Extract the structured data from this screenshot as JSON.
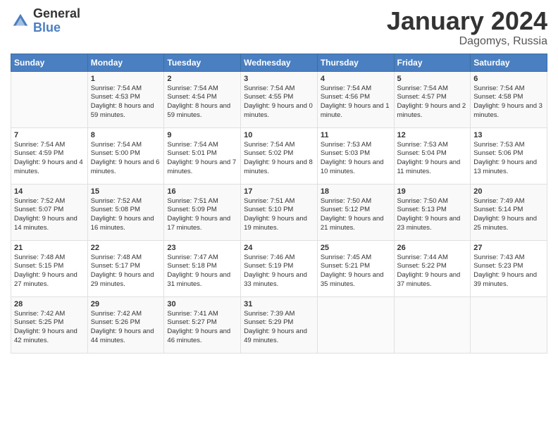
{
  "header": {
    "logo_general": "General",
    "logo_blue": "Blue",
    "month_title": "January 2024",
    "subtitle": "Dagomys, Russia"
  },
  "days_of_week": [
    "Sunday",
    "Monday",
    "Tuesday",
    "Wednesday",
    "Thursday",
    "Friday",
    "Saturday"
  ],
  "weeks": [
    [
      {
        "day": "",
        "sunrise": "",
        "sunset": "",
        "daylight": ""
      },
      {
        "day": "1",
        "sunrise": "Sunrise: 7:54 AM",
        "sunset": "Sunset: 4:53 PM",
        "daylight": "Daylight: 8 hours and 59 minutes."
      },
      {
        "day": "2",
        "sunrise": "Sunrise: 7:54 AM",
        "sunset": "Sunset: 4:54 PM",
        "daylight": "Daylight: 8 hours and 59 minutes."
      },
      {
        "day": "3",
        "sunrise": "Sunrise: 7:54 AM",
        "sunset": "Sunset: 4:55 PM",
        "daylight": "Daylight: 9 hours and 0 minutes."
      },
      {
        "day": "4",
        "sunrise": "Sunrise: 7:54 AM",
        "sunset": "Sunset: 4:56 PM",
        "daylight": "Daylight: 9 hours and 1 minute."
      },
      {
        "day": "5",
        "sunrise": "Sunrise: 7:54 AM",
        "sunset": "Sunset: 4:57 PM",
        "daylight": "Daylight: 9 hours and 2 minutes."
      },
      {
        "day": "6",
        "sunrise": "Sunrise: 7:54 AM",
        "sunset": "Sunset: 4:58 PM",
        "daylight": "Daylight: 9 hours and 3 minutes."
      }
    ],
    [
      {
        "day": "7",
        "sunrise": "Sunrise: 7:54 AM",
        "sunset": "Sunset: 4:59 PM",
        "daylight": "Daylight: 9 hours and 4 minutes."
      },
      {
        "day": "8",
        "sunrise": "Sunrise: 7:54 AM",
        "sunset": "Sunset: 5:00 PM",
        "daylight": "Daylight: 9 hours and 6 minutes."
      },
      {
        "day": "9",
        "sunrise": "Sunrise: 7:54 AM",
        "sunset": "Sunset: 5:01 PM",
        "daylight": "Daylight: 9 hours and 7 minutes."
      },
      {
        "day": "10",
        "sunrise": "Sunrise: 7:54 AM",
        "sunset": "Sunset: 5:02 PM",
        "daylight": "Daylight: 9 hours and 8 minutes."
      },
      {
        "day": "11",
        "sunrise": "Sunrise: 7:53 AM",
        "sunset": "Sunset: 5:03 PM",
        "daylight": "Daylight: 9 hours and 10 minutes."
      },
      {
        "day": "12",
        "sunrise": "Sunrise: 7:53 AM",
        "sunset": "Sunset: 5:04 PM",
        "daylight": "Daylight: 9 hours and 11 minutes."
      },
      {
        "day": "13",
        "sunrise": "Sunrise: 7:53 AM",
        "sunset": "Sunset: 5:06 PM",
        "daylight": "Daylight: 9 hours and 13 minutes."
      }
    ],
    [
      {
        "day": "14",
        "sunrise": "Sunrise: 7:52 AM",
        "sunset": "Sunset: 5:07 PM",
        "daylight": "Daylight: 9 hours and 14 minutes."
      },
      {
        "day": "15",
        "sunrise": "Sunrise: 7:52 AM",
        "sunset": "Sunset: 5:08 PM",
        "daylight": "Daylight: 9 hours and 16 minutes."
      },
      {
        "day": "16",
        "sunrise": "Sunrise: 7:51 AM",
        "sunset": "Sunset: 5:09 PM",
        "daylight": "Daylight: 9 hours and 17 minutes."
      },
      {
        "day": "17",
        "sunrise": "Sunrise: 7:51 AM",
        "sunset": "Sunset: 5:10 PM",
        "daylight": "Daylight: 9 hours and 19 minutes."
      },
      {
        "day": "18",
        "sunrise": "Sunrise: 7:50 AM",
        "sunset": "Sunset: 5:12 PM",
        "daylight": "Daylight: 9 hours and 21 minutes."
      },
      {
        "day": "19",
        "sunrise": "Sunrise: 7:50 AM",
        "sunset": "Sunset: 5:13 PM",
        "daylight": "Daylight: 9 hours and 23 minutes."
      },
      {
        "day": "20",
        "sunrise": "Sunrise: 7:49 AM",
        "sunset": "Sunset: 5:14 PM",
        "daylight": "Daylight: 9 hours and 25 minutes."
      }
    ],
    [
      {
        "day": "21",
        "sunrise": "Sunrise: 7:48 AM",
        "sunset": "Sunset: 5:15 PM",
        "daylight": "Daylight: 9 hours and 27 minutes."
      },
      {
        "day": "22",
        "sunrise": "Sunrise: 7:48 AM",
        "sunset": "Sunset: 5:17 PM",
        "daylight": "Daylight: 9 hours and 29 minutes."
      },
      {
        "day": "23",
        "sunrise": "Sunrise: 7:47 AM",
        "sunset": "Sunset: 5:18 PM",
        "daylight": "Daylight: 9 hours and 31 minutes."
      },
      {
        "day": "24",
        "sunrise": "Sunrise: 7:46 AM",
        "sunset": "Sunset: 5:19 PM",
        "daylight": "Daylight: 9 hours and 33 minutes."
      },
      {
        "day": "25",
        "sunrise": "Sunrise: 7:45 AM",
        "sunset": "Sunset: 5:21 PM",
        "daylight": "Daylight: 9 hours and 35 minutes."
      },
      {
        "day": "26",
        "sunrise": "Sunrise: 7:44 AM",
        "sunset": "Sunset: 5:22 PM",
        "daylight": "Daylight: 9 hours and 37 minutes."
      },
      {
        "day": "27",
        "sunrise": "Sunrise: 7:43 AM",
        "sunset": "Sunset: 5:23 PM",
        "daylight": "Daylight: 9 hours and 39 minutes."
      }
    ],
    [
      {
        "day": "28",
        "sunrise": "Sunrise: 7:42 AM",
        "sunset": "Sunset: 5:25 PM",
        "daylight": "Daylight: 9 hours and 42 minutes."
      },
      {
        "day": "29",
        "sunrise": "Sunrise: 7:42 AM",
        "sunset": "Sunset: 5:26 PM",
        "daylight": "Daylight: 9 hours and 44 minutes."
      },
      {
        "day": "30",
        "sunrise": "Sunrise: 7:41 AM",
        "sunset": "Sunset: 5:27 PM",
        "daylight": "Daylight: 9 hours and 46 minutes."
      },
      {
        "day": "31",
        "sunrise": "Sunrise: 7:39 AM",
        "sunset": "Sunset: 5:29 PM",
        "daylight": "Daylight: 9 hours and 49 minutes."
      },
      {
        "day": "",
        "sunrise": "",
        "sunset": "",
        "daylight": ""
      },
      {
        "day": "",
        "sunrise": "",
        "sunset": "",
        "daylight": ""
      },
      {
        "day": "",
        "sunrise": "",
        "sunset": "",
        "daylight": ""
      }
    ]
  ]
}
